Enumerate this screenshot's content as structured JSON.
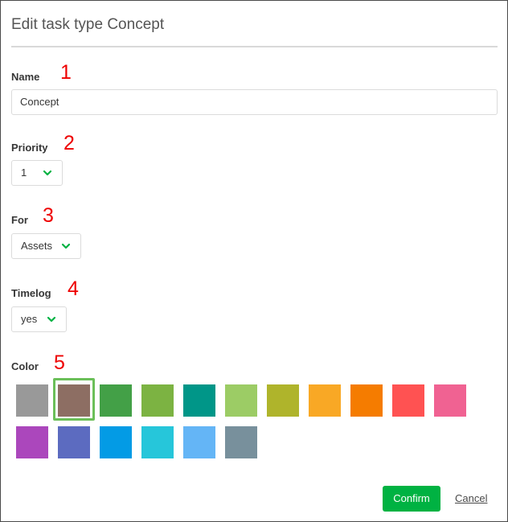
{
  "dialog": {
    "title": "Edit task type Concept",
    "confirm_label": "Confirm",
    "cancel_label": "Cancel"
  },
  "fields": {
    "name": {
      "label": "Name",
      "value": "Concept",
      "annotation": "1"
    },
    "priority": {
      "label": "Priority",
      "value": "1",
      "annotation": "2"
    },
    "for": {
      "label": "For",
      "value": "Assets",
      "annotation": "3"
    },
    "timelog": {
      "label": "Timelog",
      "value": "yes",
      "annotation": "4"
    },
    "color": {
      "label": "Color",
      "annotation": "5",
      "selected": "#8d6e63",
      "swatches": [
        "#999999",
        "#8d6e63",
        "#43a047",
        "#7cb342",
        "#009688",
        "#9ccc65",
        "#afb42b",
        "#f9a825",
        "#f57c00",
        "#ff5252",
        "#f06292",
        "#ab47bc",
        "#5c6bc0",
        "#039be5",
        "#26c6da",
        "#64b5f6",
        "#78909c"
      ]
    }
  },
  "colors": {
    "accent": "#00b242",
    "annotation": "#ee0000",
    "chevron": "#00b242"
  },
  "icons": {
    "select_chevron": "chevron-down-icon"
  }
}
